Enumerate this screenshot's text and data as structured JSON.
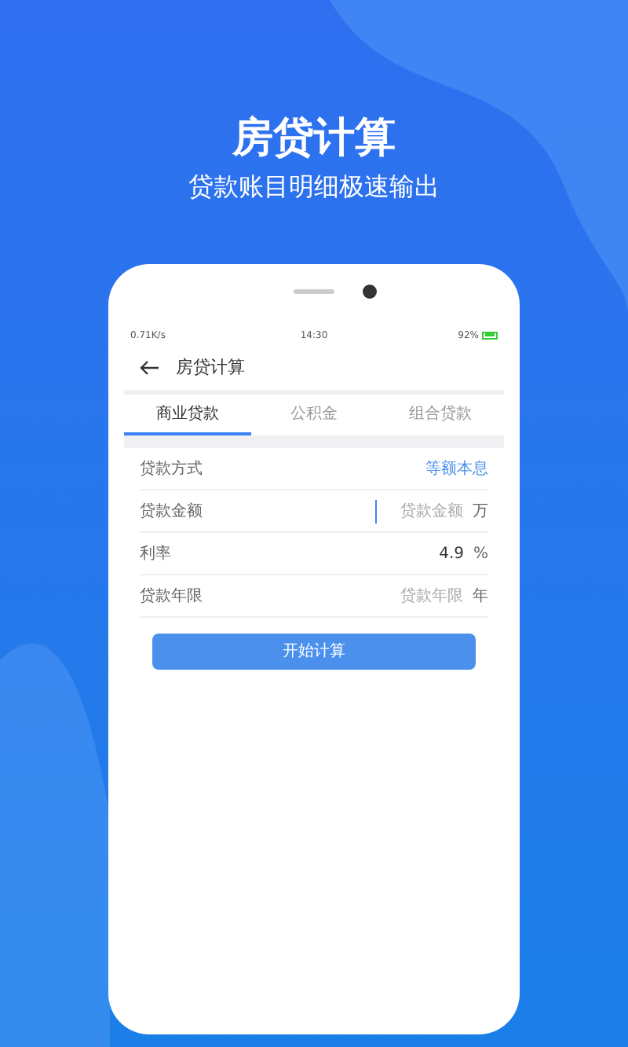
{
  "headline": "房贷计算",
  "subtitle": "贷款账目明细极速输出",
  "status_bar": {
    "speed": "0.71K/s",
    "time": "14:30",
    "battery": "92%"
  },
  "app_bar": {
    "title": "房贷计算"
  },
  "tabs": [
    {
      "label": "商业贷款",
      "selected": true
    },
    {
      "label": "公积金",
      "selected": false
    },
    {
      "label": "组合贷款",
      "selected": false
    }
  ],
  "form": [
    {
      "kind": "select",
      "label": "贷款方式",
      "value": "等额本息"
    },
    {
      "kind": "input",
      "label": "贷款金额",
      "placeholder": "贷款金额",
      "unit": "万",
      "focused": true
    },
    {
      "kind": "input",
      "label": "利率",
      "value": "4.9",
      "unit": "%",
      "focused": false
    },
    {
      "kind": "input",
      "label": "贷款年限",
      "placeholder": "贷款年限",
      "unit": "年",
      "focused": false
    }
  ],
  "button": "开始计算"
}
